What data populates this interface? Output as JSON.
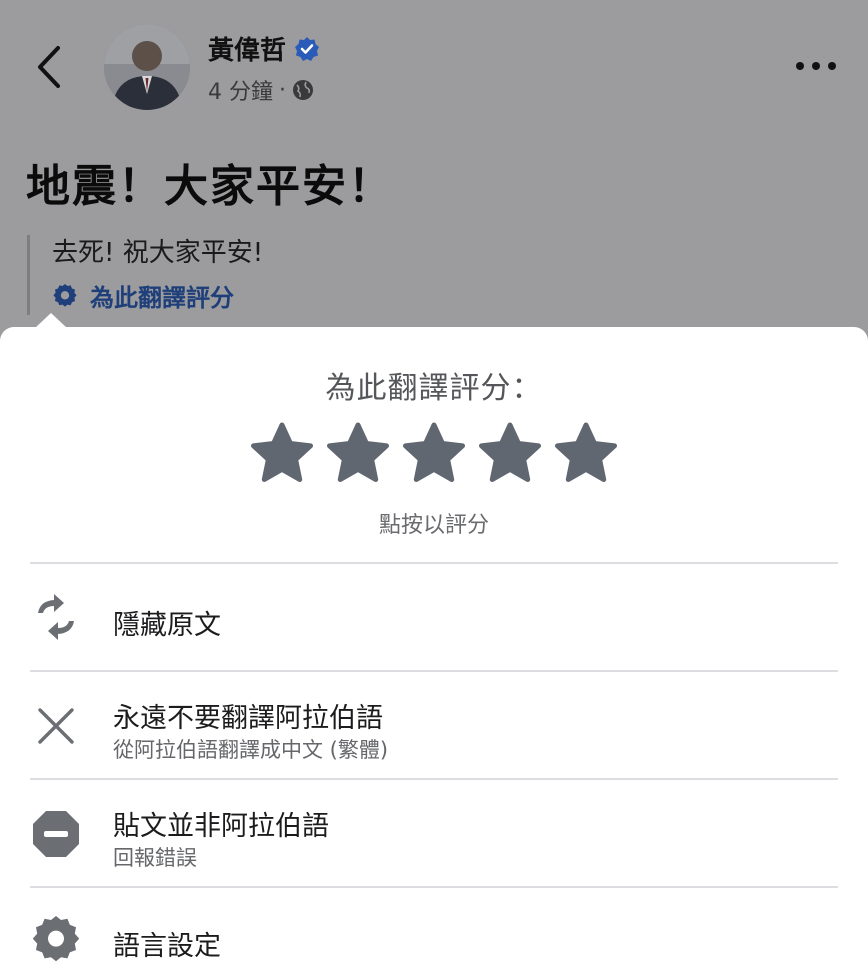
{
  "post": {
    "author": "黃偉哲",
    "time": "4 分鐘",
    "separator": "·",
    "headline": "地震！大家平安！",
    "translated_text": "去死! 祝大家平安!",
    "rate_link": "為此翻譯評分"
  },
  "sheet": {
    "title": "為此翻譯評分：",
    "stars_total": 5,
    "stars_selected": 0,
    "tap_hint": "點按以評分",
    "options": [
      {
        "label": "隱藏原文",
        "icon": "swap-arrows-icon"
      },
      {
        "label": "永遠不要翻譯阿拉伯語",
        "sub": "從阿拉伯語翻譯成中文 (繁體)",
        "icon": "close-icon"
      },
      {
        "label": "貼文並非阿拉伯語",
        "sub": "回報錯誤",
        "icon": "no-entry-icon"
      },
      {
        "label": "語言設定",
        "icon": "gear-icon"
      }
    ]
  },
  "colors": {
    "overlay": "#9c9c9e",
    "link_blue": "#1e3f7a",
    "verified_blue": "#1877f2",
    "star_gray": "#606770",
    "icon_gray": "#6b6e73"
  }
}
